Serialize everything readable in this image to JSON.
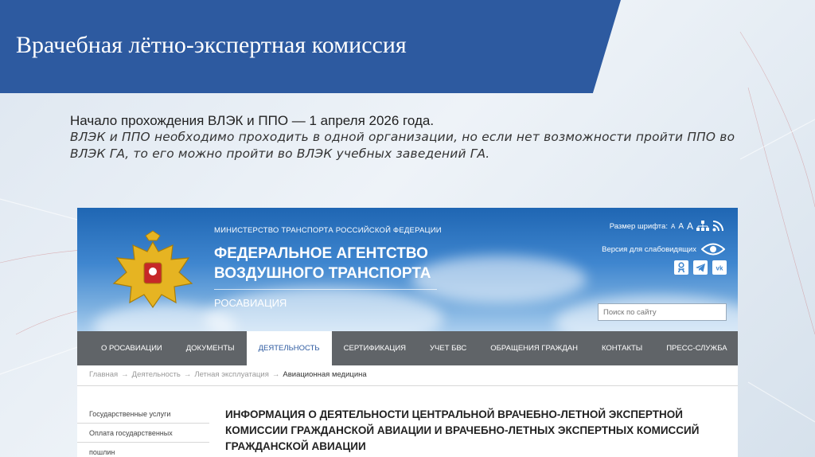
{
  "slide": {
    "title": "Врачебная лётно-экспертная комиссия",
    "intro_line1": "Начало прохождения ВЛЭК и ППО — 1 апреля 2026 года.",
    "intro_rest": "ВЛЭК и ППО необходимо проходить в одной организации, но если нет возможности пройти ППО во ВЛЭК ГА, то его можно пройти во ВЛЭК учебных заведений ГА."
  },
  "site": {
    "ministry": "МИНИСТЕРСТВО ТРАНСПОРТА РОССИЙСКОЙ ФЕДЕРАЦИИ",
    "agency": "ФЕДЕРАЛЬНОЕ АГЕНТСТВО ВОЗДУШНОГО ТРАНСПОРТА",
    "agency_short": "РОСАВИАЦИЯ",
    "font_size_label": "Размер шрифта:",
    "font_size_options": [
      "А",
      "А",
      "А"
    ],
    "vision_version_label": "Версия для слабовидящих",
    "search_placeholder": "Поиск по сайту",
    "nav": [
      {
        "label": "О РОСАВИАЦИИ",
        "active": false
      },
      {
        "label": "ДОКУМЕНТЫ",
        "active": false
      },
      {
        "label": "ДЕЯТЕЛЬНОСТЬ",
        "active": true
      },
      {
        "label": "СЕРТИФИКАЦИЯ",
        "active": false
      },
      {
        "label": "УЧЕТ БВС",
        "active": false
      },
      {
        "label": "ОБРАЩЕНИЯ ГРАЖДАН",
        "active": false
      },
      {
        "label": "КОНТАКТЫ",
        "active": false
      },
      {
        "label": "ПРЕСС-СЛУЖБА",
        "active": false
      }
    ],
    "breadcrumb": {
      "items": [
        "Главная",
        "Деятельность",
        "Летная эксплуатация"
      ],
      "separator": "→",
      "current": "Авиационная медицина"
    },
    "side_menu": [
      "Государственные услуги",
      "Оплата государственных пошлин"
    ],
    "content_title": "ИНФОРМАЦИЯ О ДЕЯТЕЛЬНОСТИ ЦЕНТРАЛЬНОЙ ВРАЧЕБНО-ЛЕТНОЙ ЭКСПЕРТНОЙ КОМИССИИ ГРАЖДАНСКОЙ АВИАЦИИ И ВРАЧЕБНО-ЛЕТНЫХ ЭКСПЕРТНЫХ КОМИССИЙ ГРАЖДАНСКОЙ АВИАЦИИ"
  },
  "colors": {
    "title_band": "#2d5aa0",
    "nav_background": "#606468",
    "nav_active_text": "#2d5aa0"
  }
}
